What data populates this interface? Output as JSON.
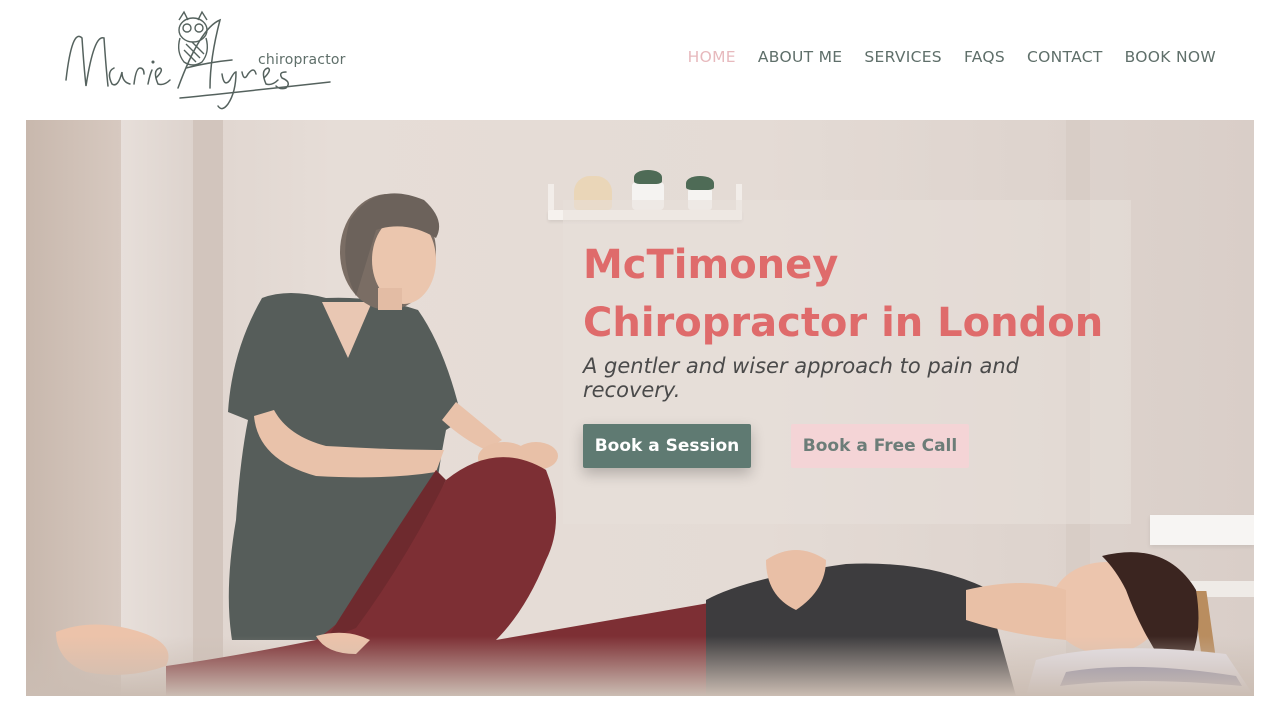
{
  "brand": {
    "logo_alt": "Marie Ayres",
    "tagline": "chiropractor"
  },
  "nav": {
    "items": [
      "HOME",
      "ABOUT ME",
      "SERVICES",
      "FAQS",
      "CONTACT",
      "BOOK NOW"
    ],
    "active_index": 0
  },
  "hero": {
    "title": "McTimoney Chiropractor in London",
    "subtitle": "A gentler and wiser approach to pain and recovery.",
    "primary_button": "Book a Session",
    "secondary_button": "Book a Free Call",
    "image_description": "Chiropractor treating a patient's knee"
  },
  "colors": {
    "accent_coral": "#df6b6b",
    "accent_pink": "#e7b9bd",
    "nav_text": "#5f6f6a",
    "button_primary": "#5f7a72",
    "button_secondary": "#f4d4d6"
  }
}
